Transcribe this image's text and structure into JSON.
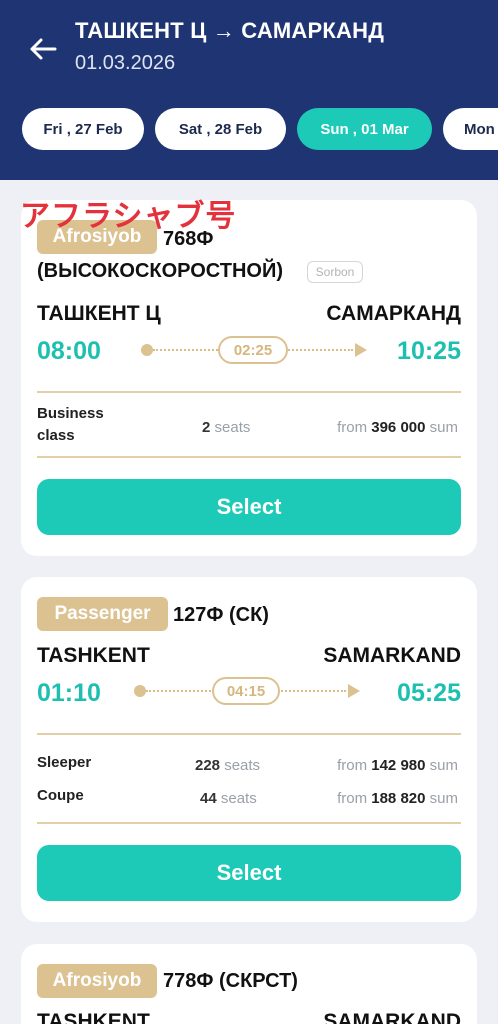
{
  "header": {
    "route": "ТАШКЕНТ Ц → САМАРКАНД",
    "date": "01.03.2026"
  },
  "dates": [
    {
      "label": "Fri , 27 Feb",
      "active": false
    },
    {
      "label": "Sat , 28 Feb",
      "active": false
    },
    {
      "label": "Sun , 01 Mar",
      "active": true
    },
    {
      "label": "Mon",
      "active": false
    }
  ],
  "overlay_note": "アフラシャブ号",
  "trains": [
    {
      "badge": "Afrosiyob",
      "number": "768Ф",
      "type": "(ВЫСОКОСКОРОСТНОЙ)",
      "tag": "Sorbon",
      "from": "ТАШКЕНТ Ц",
      "to": "САМАРКАНД",
      "depart": "08:00",
      "duration": "02:25",
      "arrive": "10:25",
      "classes": [
        {
          "name": "Business class",
          "seats_count": "2",
          "seats_label": "seats",
          "from_label": "from",
          "price": "396 000",
          "currency": "sum"
        }
      ],
      "select_label": "Select"
    },
    {
      "badge": "Passenger",
      "number": "127Ф (СК)",
      "from": "TASHKENT",
      "to": "SAMARKAND",
      "depart": "01:10",
      "duration": "04:15",
      "arrive": "05:25",
      "classes": [
        {
          "name": "Sleeper",
          "seats_count": "228",
          "seats_label": "seats",
          "from_label": "from",
          "price": "142 980",
          "currency": "sum"
        },
        {
          "name": "Coupe",
          "seats_count": "44",
          "seats_label": "seats",
          "from_label": "from",
          "price": "188 820",
          "currency": "sum"
        }
      ],
      "select_label": "Select"
    },
    {
      "badge": "Afrosiyob",
      "number": "778Ф (СКРСТ)",
      "from": "TASHKENT",
      "to": "SAMARKAND"
    }
  ],
  "colors": {
    "header_bg": "#1f3472",
    "accent": "#1dc9b7",
    "badge": "#dcc291",
    "note_red": "#e4323c"
  }
}
